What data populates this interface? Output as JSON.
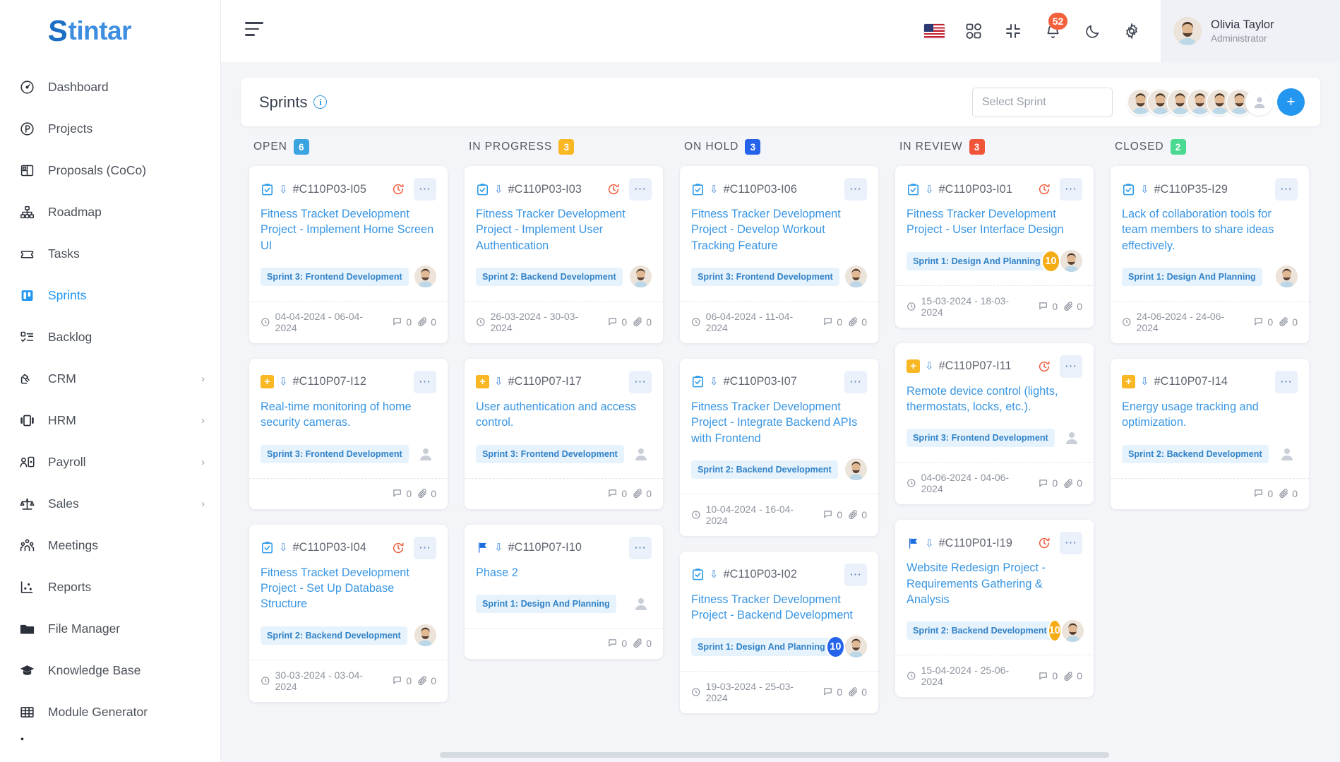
{
  "brand": {
    "name": "Stintar",
    "initial": "S",
    "rest": "tintar"
  },
  "sidebar": {
    "items": [
      {
        "label": "Dashboard",
        "icon": "speedometer-icon",
        "active": false,
        "expandable": false
      },
      {
        "label": "Projects",
        "icon": "circle-p-icon",
        "active": false,
        "expandable": false
      },
      {
        "label": "Proposals (CoCo)",
        "icon": "layout-panels-icon",
        "active": false,
        "expandable": false
      },
      {
        "label": "Roadmap",
        "icon": "hierarchy-icon",
        "active": false,
        "expandable": false
      },
      {
        "label": "Tasks",
        "icon": "ticket-icon",
        "active": false,
        "expandable": false
      },
      {
        "label": "Sprints",
        "icon": "board-icon",
        "active": true,
        "expandable": false
      },
      {
        "label": "Backlog",
        "icon": "checklist-icon",
        "active": false,
        "expandable": false
      },
      {
        "label": "CRM",
        "icon": "handshake-icon",
        "active": false,
        "expandable": true
      },
      {
        "label": "HRM",
        "icon": "carousel-icon",
        "active": false,
        "expandable": true
      },
      {
        "label": "Payroll",
        "icon": "user-card-icon",
        "active": false,
        "expandable": true
      },
      {
        "label": "Sales",
        "icon": "scales-icon",
        "active": false,
        "expandable": true
      },
      {
        "label": "Meetings",
        "icon": "people-group-icon",
        "active": false,
        "expandable": false
      },
      {
        "label": "Reports",
        "icon": "scatter-chart-icon",
        "active": false,
        "expandable": false
      },
      {
        "label": "File Manager",
        "icon": "folder-icon",
        "active": false,
        "expandable": false
      },
      {
        "label": "Knowledge Base",
        "icon": "graduation-cap-icon",
        "active": false,
        "expandable": false
      },
      {
        "label": "Module Generator",
        "icon": "grid-table-icon",
        "active": false,
        "expandable": false
      }
    ],
    "chevron": "›"
  },
  "topbar": {
    "menu_icon": "hamburger-icon",
    "language_flag": "us-flag-icon",
    "apps_icon": "apps-grid-icon",
    "fullscreen_icon": "collapse-fullscreen-icon",
    "notification_icon": "bell-icon",
    "notification_count": "52",
    "theme_icon": "moon-icon",
    "settings_icon": "gear-icon",
    "user": {
      "name": "Olivia Taylor",
      "role": "Administrator"
    }
  },
  "sprint_bar": {
    "title": "Sprints",
    "info_icon": "info-icon",
    "select_placeholder": "Select Sprint",
    "avatar_count": 6,
    "ghost_avatar_icon": "user-placeholder-icon",
    "add_label": "+"
  },
  "colors": {
    "open": "#3aa4e0",
    "in_progress": "#f9b723",
    "on_hold": "#2563eb",
    "in_review": "#f0553a",
    "closed": "#4ad991",
    "accent": "#2396ef",
    "link": "#3996e3",
    "chip_bg": "#e7f3fc",
    "chip_text": "#3182c8"
  },
  "board": {
    "columns": [
      {
        "title": "OPEN",
        "count": "6",
        "badge_color": "#3aa4e0",
        "cards": [
          {
            "type": "task",
            "id": "#C110P03-I05",
            "overdue": true,
            "title": "Fitness Tracket Development Project - Implement Home Screen UI",
            "sprint": "Sprint 3: Frontend Development",
            "points": "",
            "has_user": true,
            "dates": "04-04-2024 - 06-04-2024",
            "comments": "0",
            "attachments": "0"
          },
          {
            "type": "feature",
            "id": "#C110P07-I12",
            "overdue": false,
            "title": "Real-time monitoring of home security cameras.",
            "sprint": "Sprint 3: Frontend Development",
            "points": "",
            "has_user": false,
            "dates": "",
            "comments": "0",
            "attachments": "0"
          },
          {
            "type": "task",
            "id": "#C110P03-I04",
            "overdue": true,
            "title": "Fitness Tracket Development Project - Set Up Database Structure",
            "sprint": "Sprint 2: Backend Development",
            "points": "",
            "has_user": true,
            "dates": "30-03-2024 - 03-04-2024",
            "comments": "0",
            "attachments": "0"
          }
        ]
      },
      {
        "title": "IN PROGRESS",
        "count": "3",
        "badge_color": "#f9b723",
        "cards": [
          {
            "type": "task",
            "id": "#C110P03-I03",
            "overdue": true,
            "title": "Fitness Tracker Development Project - Implement User Authentication",
            "sprint": "Sprint 2: Backend Development",
            "points": "",
            "has_user": true,
            "dates": "26-03-2024 - 30-03-2024",
            "comments": "0",
            "attachments": "0"
          },
          {
            "type": "feature",
            "id": "#C110P07-I17",
            "overdue": false,
            "title": "User authentication and access control.",
            "sprint": "Sprint 3: Frontend Development",
            "points": "",
            "has_user": false,
            "dates": "",
            "comments": "0",
            "attachments": "0"
          },
          {
            "type": "flag",
            "id": "#C110P07-I10",
            "overdue": false,
            "title": "Phase 2",
            "sprint": "Sprint 1: Design And Planning",
            "points": "",
            "has_user": false,
            "dates": "",
            "comments": "0",
            "attachments": "0"
          }
        ]
      },
      {
        "title": "ON HOLD",
        "count": "3",
        "badge_color": "#2563eb",
        "cards": [
          {
            "type": "task",
            "id": "#C110P03-I06",
            "overdue": false,
            "title": "Fitness Tracker Development Project - Develop Workout Tracking Feature",
            "sprint": "Sprint 3: Frontend Development",
            "points": "",
            "has_user": true,
            "dates": "06-04-2024 - 11-04-2024",
            "comments": "0",
            "attachments": "0"
          },
          {
            "type": "task",
            "id": "#C110P03-I07",
            "overdue": false,
            "title": "Fitness Tracker Development Project - Integrate Backend APIs with Frontend",
            "sprint": "Sprint 2: Backend Development",
            "points": "",
            "has_user": true,
            "dates": "10-04-2024 - 16-04-2024",
            "comments": "0",
            "attachments": "0"
          },
          {
            "type": "task",
            "id": "#C110P03-I02",
            "overdue": false,
            "title": "Fitness Tracker Development Project - Backend Development",
            "sprint": "Sprint 1: Design And Planning",
            "points": "10",
            "points_color": "blue",
            "has_user": true,
            "dates": "19-03-2024 - 25-03-2024",
            "comments": "0",
            "attachments": "0"
          }
        ]
      },
      {
        "title": "IN REVIEW",
        "count": "3",
        "badge_color": "#f0553a",
        "cards": [
          {
            "type": "task",
            "id": "#C110P03-I01",
            "overdue": true,
            "title": "Fitness Tracker Development Project - User Interface Design",
            "sprint": "Sprint 1: Design And Planning",
            "points": "10",
            "points_color": "orange",
            "has_user": true,
            "dates": "15-03-2024 - 18-03-2024",
            "comments": "0",
            "attachments": "0"
          },
          {
            "type": "feature",
            "id": "#C110P07-I11",
            "overdue": true,
            "title": "Remote device control (lights, thermostats, locks, etc.).",
            "sprint": "Sprint 3: Frontend Development",
            "points": "",
            "has_user": false,
            "dates": "04-06-2024 - 04-06-2024",
            "comments": "0",
            "attachments": "0"
          },
          {
            "type": "flag",
            "id": "#C110P01-I19",
            "overdue": true,
            "title": "Website Redesign Project - Requirements Gathering & Analysis",
            "sprint": "Sprint 2: Backend Development",
            "points": "10",
            "points_color": "orange",
            "has_user": true,
            "dates": "15-04-2024 - 25-06-2024",
            "comments": "0",
            "attachments": "0"
          }
        ]
      },
      {
        "title": "CLOSED",
        "count": "2",
        "badge_color": "#4ad991",
        "cards": [
          {
            "type": "task",
            "id": "#C110P35-I29",
            "overdue": false,
            "title": "Lack of collaboration tools for team members to share ideas effectively.",
            "sprint": "Sprint 1: Design And Planning",
            "points": "",
            "has_user": true,
            "dates": "24-06-2024 - 24-06-2024",
            "comments": "0",
            "attachments": "0"
          },
          {
            "type": "feature",
            "id": "#C110P07-I14",
            "overdue": false,
            "title": "Energy usage tracking and optimization.",
            "sprint": "Sprint 2: Backend Development",
            "points": "",
            "has_user": false,
            "dates": "",
            "comments": "0",
            "attachments": "0"
          }
        ]
      }
    ]
  }
}
